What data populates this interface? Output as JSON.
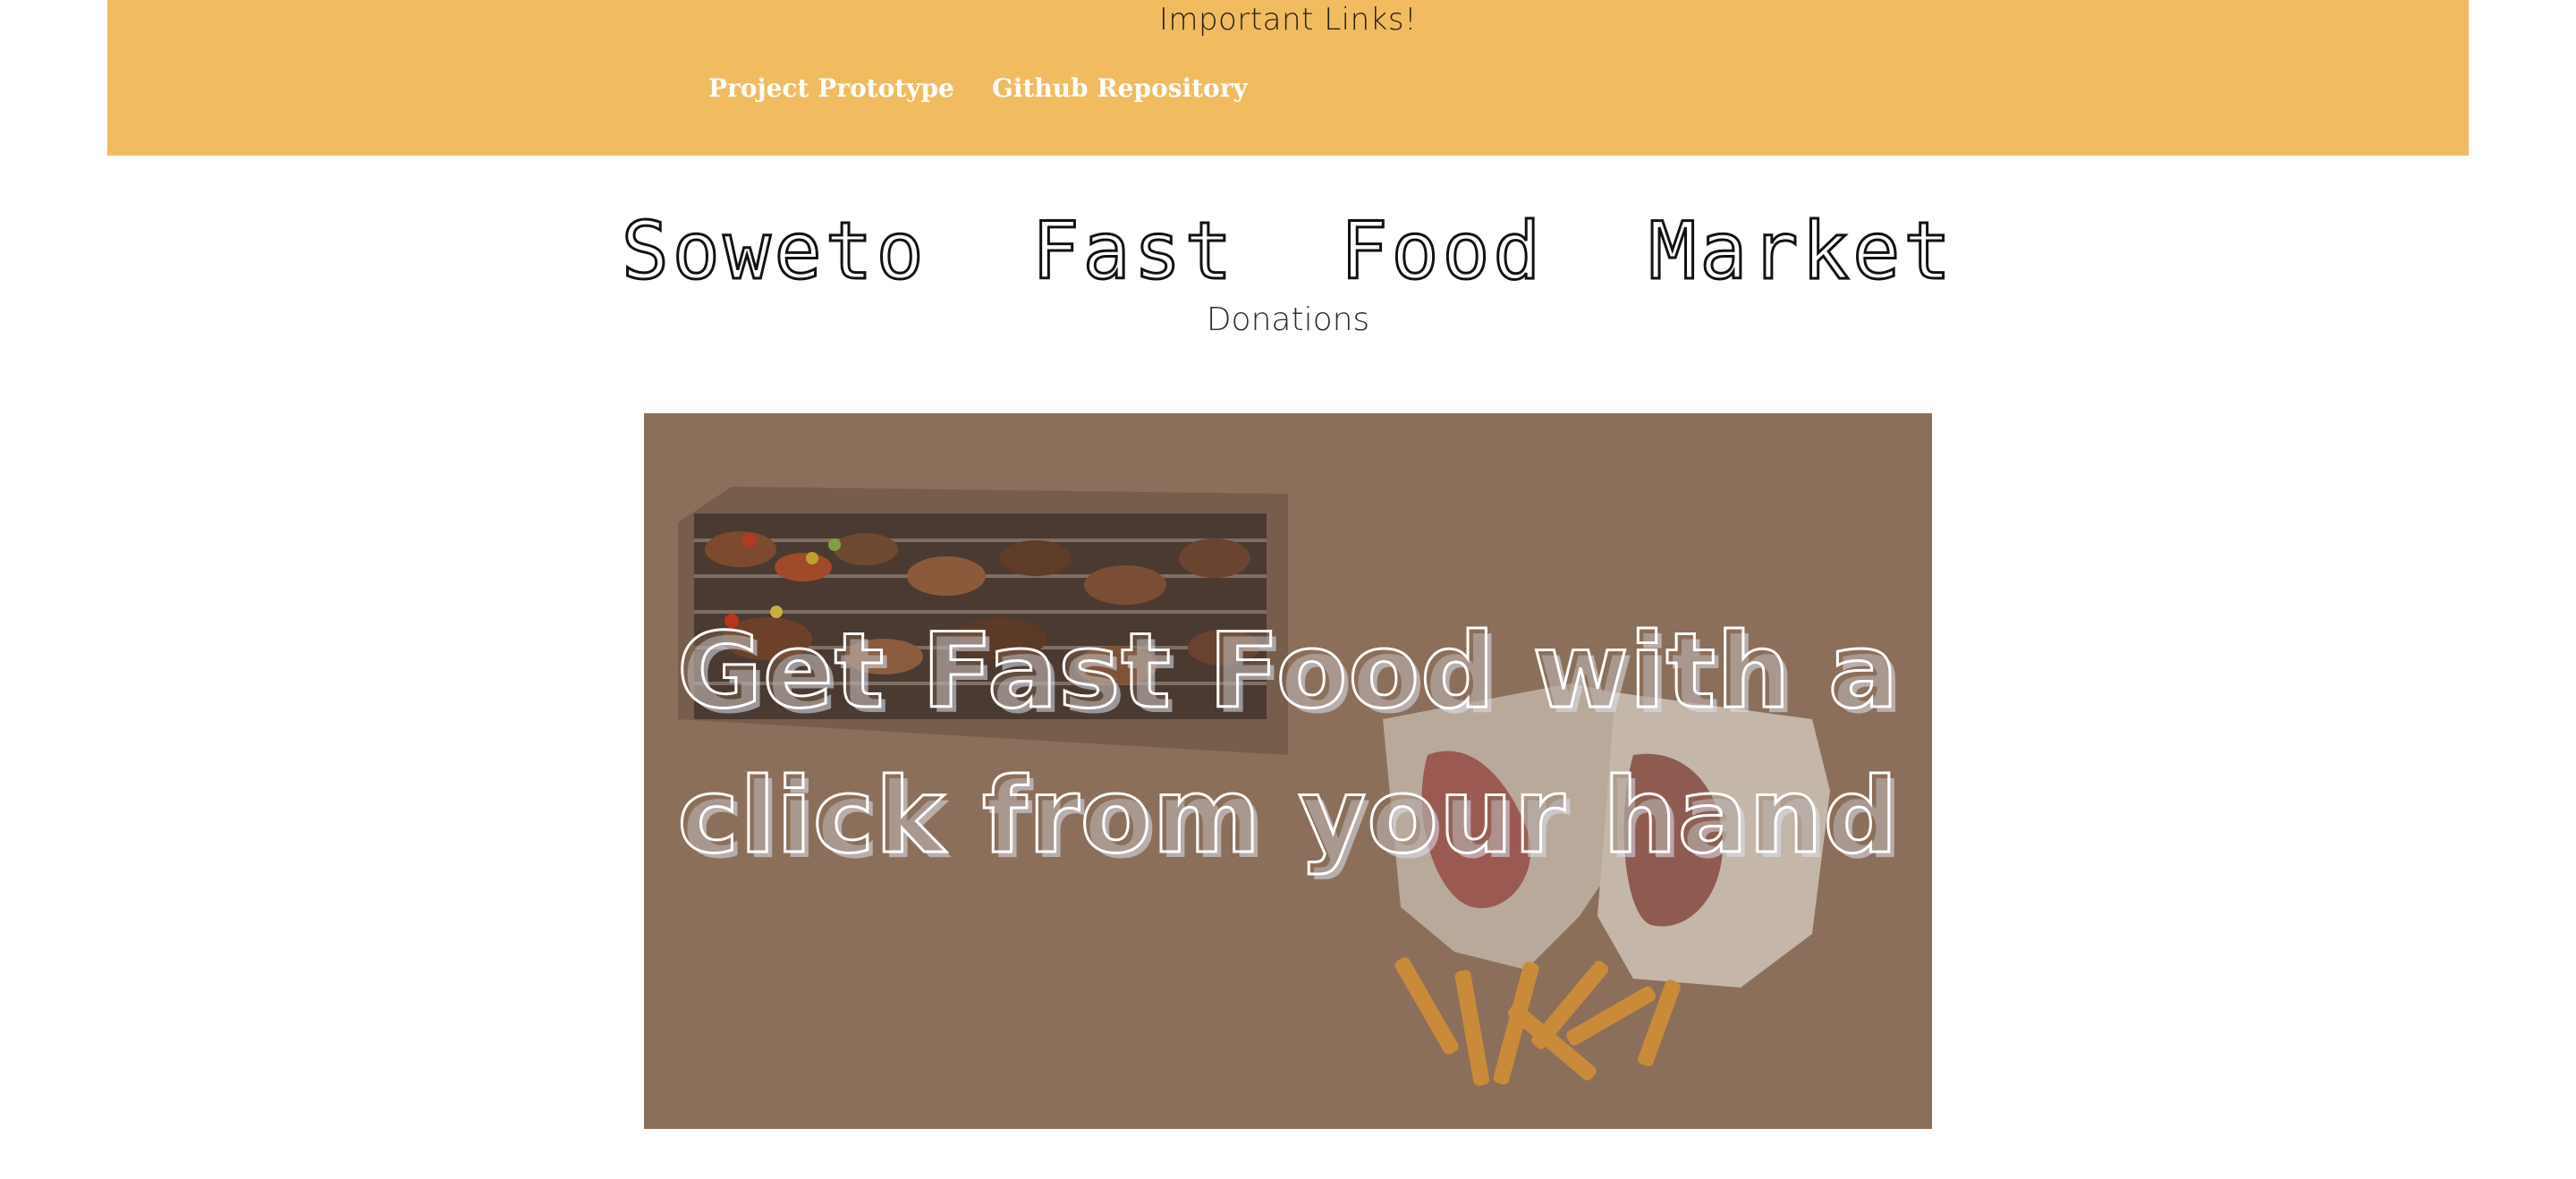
{
  "banner": {
    "heading": "Important Links!",
    "links": [
      {
        "label": "Project Prototype"
      },
      {
        "label": "Github Repository"
      }
    ]
  },
  "header": {
    "title": "Soweto Fast Food Market",
    "subtitle": "Donations"
  },
  "hero": {
    "line1": "Get Fast Food with a",
    "line2": "click from your hand",
    "images": [
      "grill-with-kebabs-and-meat",
      "sandwich-with-fries"
    ]
  },
  "colors": {
    "banner_bg": "#f1bb60",
    "hero_overlay": "#8c6f5a",
    "link_text": "#ffffff"
  }
}
